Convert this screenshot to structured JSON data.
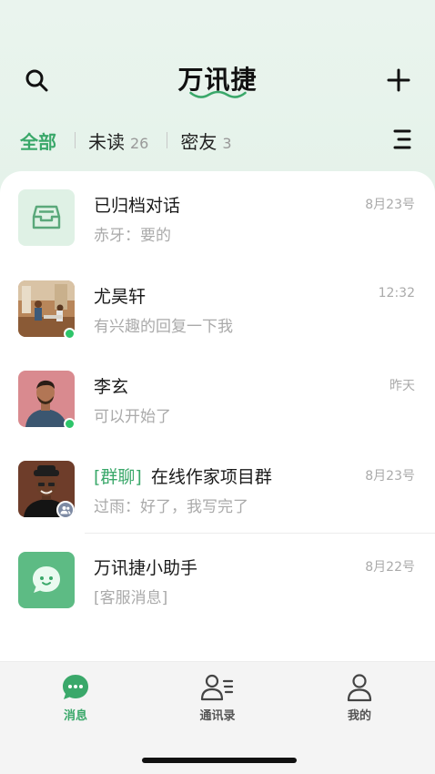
{
  "header": {
    "title": "万讯捷"
  },
  "tabs": [
    {
      "label": "全部",
      "count": ""
    },
    {
      "label": "未读",
      "count": "26"
    },
    {
      "label": "密友",
      "count": "3"
    }
  ],
  "conversations": [
    {
      "title": "已归档对话",
      "tag": "",
      "subtitle": "赤牙：要的",
      "time": "8月23号",
      "avatar": "archive-icon"
    },
    {
      "title": "尤昊轩",
      "tag": "",
      "subtitle": "有兴趣的回复一下我",
      "time": "12:32",
      "avatar": "photo-office",
      "online": true
    },
    {
      "title": "李玄",
      "tag": "",
      "subtitle": "可以开始了",
      "time": "昨天",
      "avatar": "photo-man-pink",
      "online": true
    },
    {
      "title": "在线作家项目群",
      "tag": "[群聊]",
      "subtitle": "过雨：好了，我写完了",
      "time": "8月23号",
      "avatar": "photo-man-hat",
      "group": true
    },
    {
      "title": "万讯捷小助手",
      "tag": "",
      "subtitle": "[客服消息]",
      "time": "8月22号",
      "avatar": "chat-bot-icon"
    }
  ],
  "bottom_nav": [
    {
      "label": "消息",
      "icon": "message-icon",
      "active": true
    },
    {
      "label": "通讯录",
      "icon": "contacts-icon",
      "active": false
    },
    {
      "label": "我的",
      "icon": "profile-icon",
      "active": false
    }
  ],
  "colors": {
    "accent": "#3aa86a",
    "online": "#2ec56a"
  }
}
